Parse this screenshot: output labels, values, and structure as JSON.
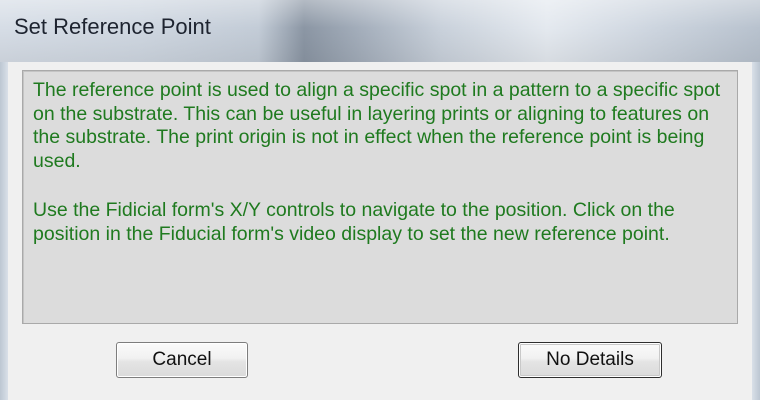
{
  "window": {
    "title": "Set Reference Point"
  },
  "message": {
    "paragraph1": "The reference point is used to align a specific spot in a pattern to a specific spot on the substrate. This can be useful in layering prints or aligning to features on the substrate. The print origin is not in effect when the reference point is being used.",
    "paragraph2": "Use the Fidicial form's X/Y controls to navigate to the position. Click on the position in the Fiducial form's video display to set the new reference point."
  },
  "buttons": {
    "cancel_label": "Cancel",
    "details_label": "No Details"
  },
  "colors": {
    "message_text": "#1f7a1f",
    "message_background": "#dcdcdc"
  }
}
